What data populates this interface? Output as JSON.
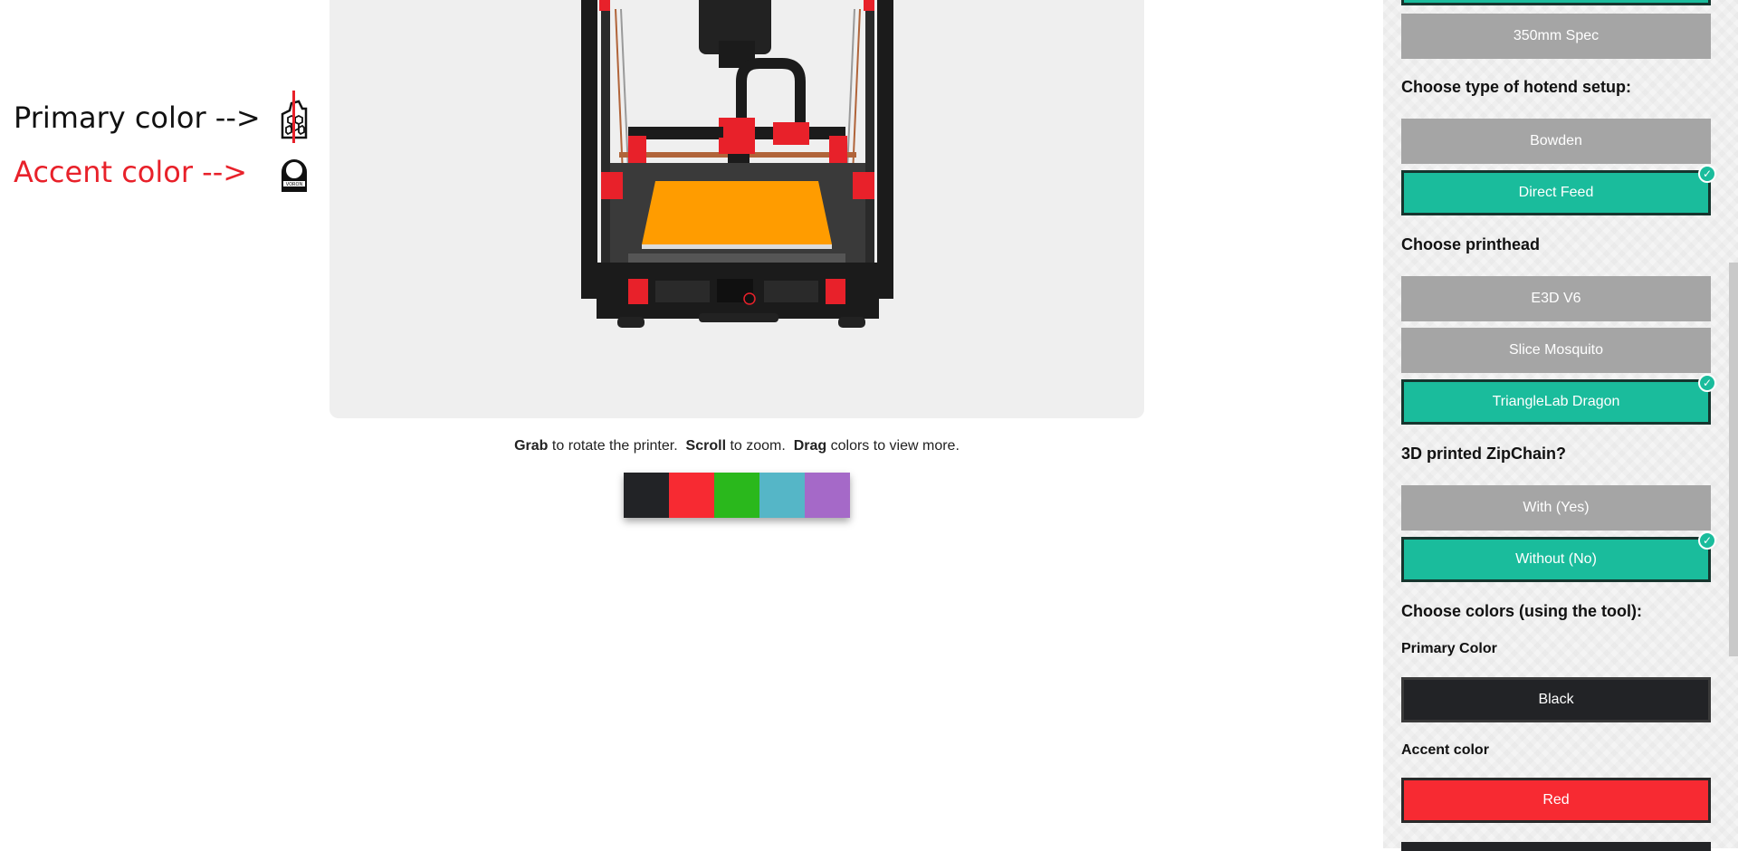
{
  "annotations": {
    "primary_label": "Primary color -->",
    "accent_label": "Accent color -->",
    "primary_icon": "hex-panel-icon",
    "accent_icon": "voron-badge-icon",
    "accent_hex": "#e8212a"
  },
  "viewer": {
    "hint_grab": "Grab",
    "hint_grab_text": " to rotate the printer.  ",
    "hint_scroll": "Scroll",
    "hint_scroll_text": " to zoom.  ",
    "hint_drag": "Drag",
    "hint_drag_text": " colors to view more.",
    "bed_color": "#ff9c00",
    "frame_color": "#1b1b1b",
    "part_color": "#e8212a"
  },
  "swatches": [
    {
      "name": "black",
      "color": "#222326"
    },
    {
      "name": "red",
      "color": "#f72a32"
    },
    {
      "name": "green",
      "color": "#2ab81c"
    },
    {
      "name": "teal",
      "color": "#55b6c7"
    },
    {
      "name": "purple",
      "color": "#a569c8"
    }
  ],
  "panel": {
    "spec_option": "350mm Spec",
    "hotend_heading": "Choose type of hotend setup:",
    "hotend_options": [
      "Bowden",
      "Direct Feed"
    ],
    "printhead_heading": "Choose printhead",
    "printhead_options": [
      "E3D V6",
      "Slice Mosquito",
      "TriangleLab Dragon"
    ],
    "zipchain_heading": "3D printed ZipChain?",
    "zipchain_options": [
      "With (Yes)",
      "Without (No)"
    ],
    "colors_heading": "Choose colors (using the tool):",
    "primary_color_label": "Primary Color",
    "primary_color_value": "Black",
    "accent_color_label": "Accent color",
    "accent_color_value": "Red",
    "check_glyph": "✓",
    "selected_color": "#1abc9c"
  }
}
